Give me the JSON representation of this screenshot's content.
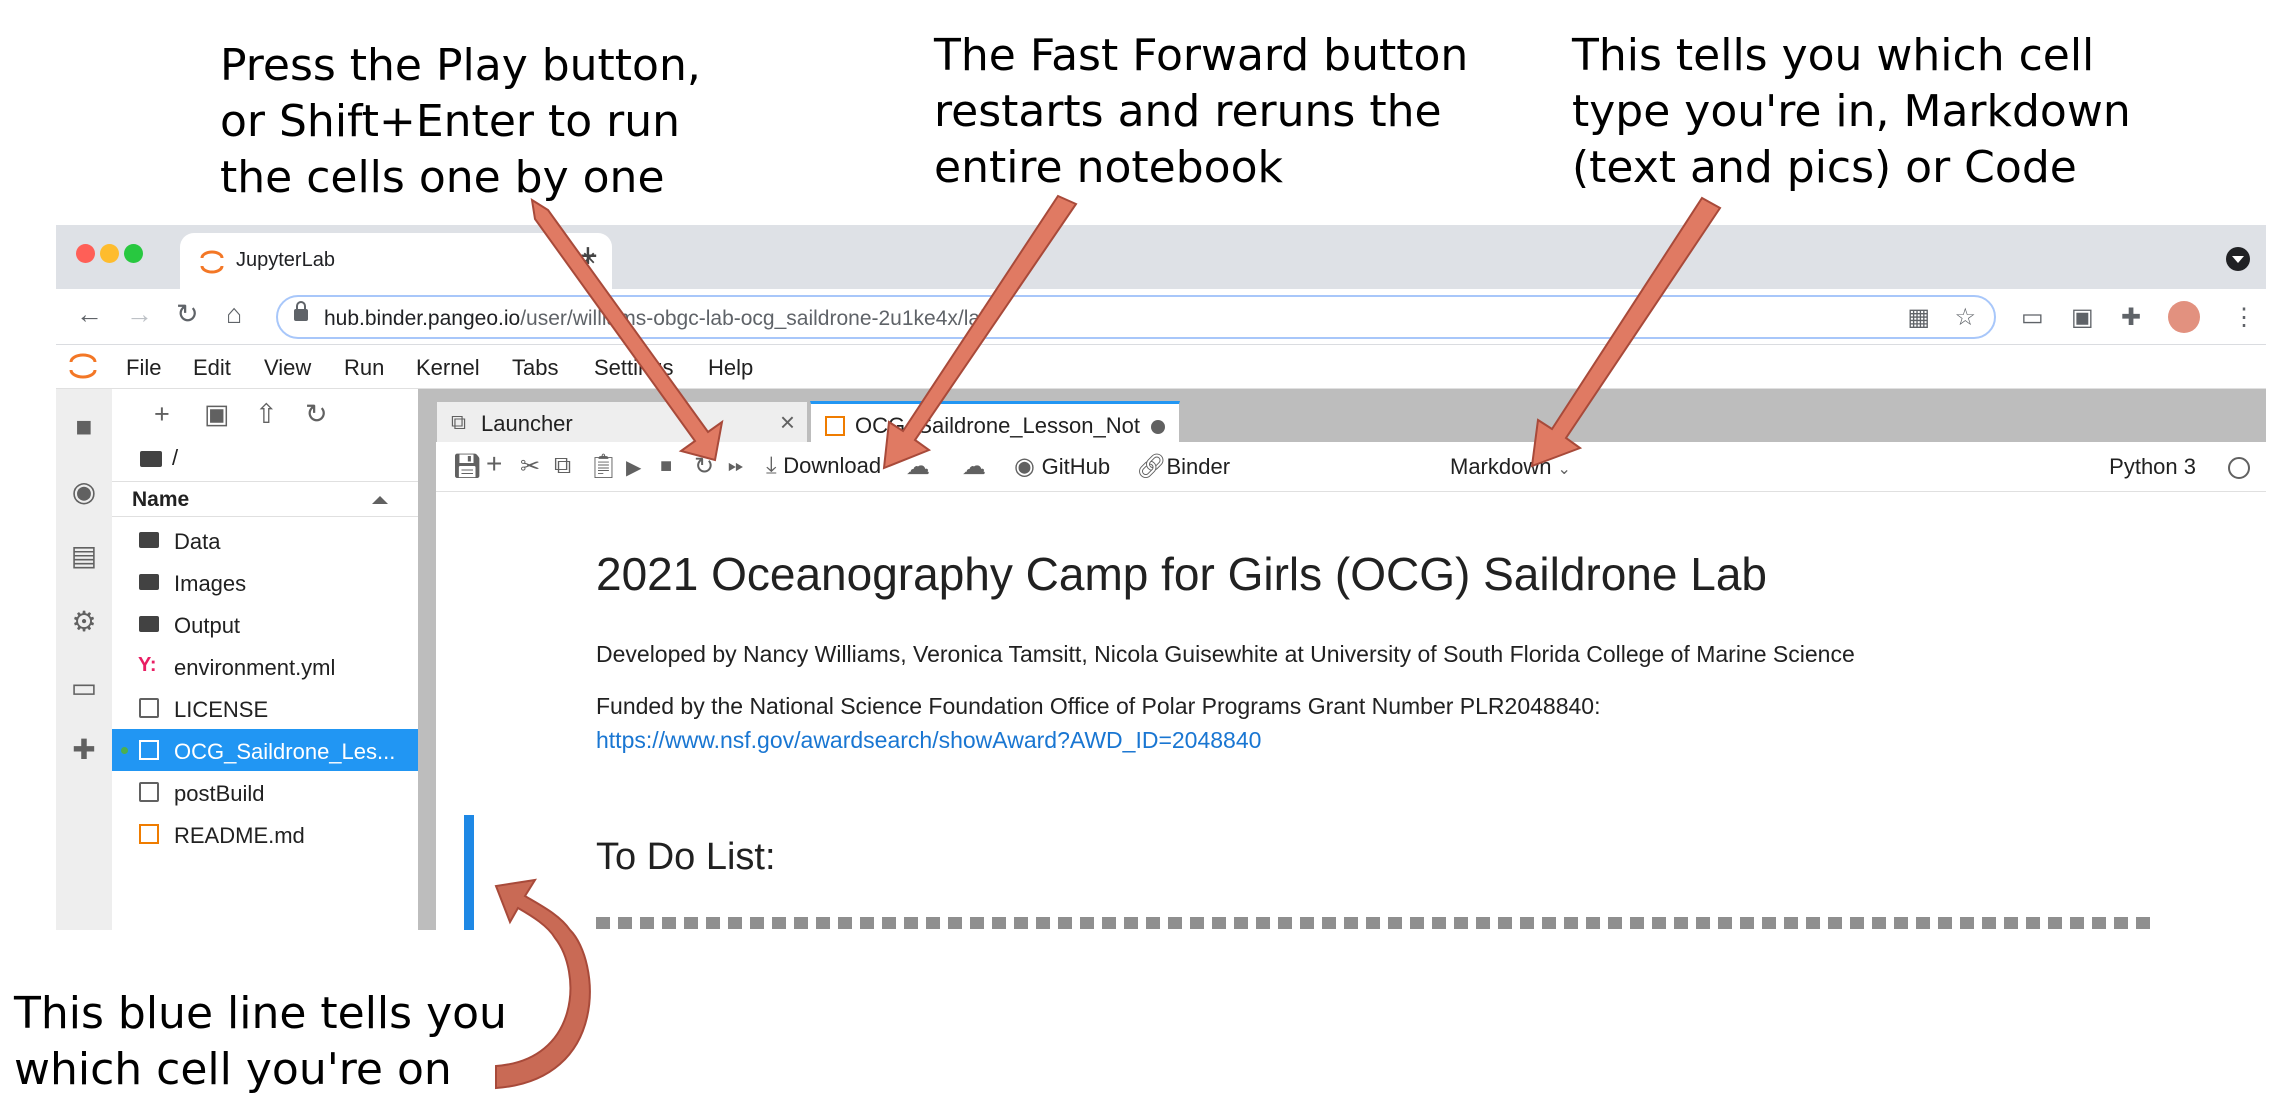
{
  "annotations": {
    "play": "Press the Play button,\nor Shift+Enter to run\nthe cells one by one",
    "fast_forward": "The Fast Forward button\nrestarts and reruns the\nentire notebook",
    "cell_type": "This tells you which cell\ntype you're in, Markdown\n(text and pics) or Code",
    "blue_line": "This blue line tells you\nwhich cell you're on"
  },
  "browser": {
    "tab_title": "JupyterLab",
    "url_host": "hub.binder.pangeo.io",
    "url_path": "/user/williams-obgc-lab-ocg_saildrone-2u1ke4x/lab"
  },
  "menu": [
    "File",
    "Edit",
    "View",
    "Run",
    "Kernel",
    "Tabs",
    "Settings",
    "Help"
  ],
  "filebrowser": {
    "path": "/",
    "header": "Name",
    "files": [
      {
        "name": "Data",
        "type": "folder"
      },
      {
        "name": "Images",
        "type": "folder"
      },
      {
        "name": "Output",
        "type": "folder"
      },
      {
        "name": "environment.yml",
        "type": "yml"
      },
      {
        "name": "LICENSE",
        "type": "file"
      },
      {
        "name": "OCG_Saildrone_Les...",
        "type": "notebook"
      },
      {
        "name": "postBuild",
        "type": "file"
      },
      {
        "name": "README.md",
        "type": "markdown"
      }
    ]
  },
  "tabs": {
    "launcher": "Launcher",
    "notebook": "OCG_Saildrone_Lesson_Not"
  },
  "toolbar": {
    "download": "Download",
    "github": "GitHub",
    "binder": "Binder",
    "cell_type": "Markdown",
    "kernel": "Python 3"
  },
  "notebook": {
    "title": "2021 Oceanography Camp for Girls (OCG) Saildrone Lab",
    "developed": "Developed by Nancy Williams, Veronica Tamsitt, Nicola Guisewhite at University of South Florida College of Marine Science",
    "funded": "Funded by the National Science Foundation Office of Polar Programs Grant Number PLR2048840:",
    "link": "https://www.nsf.gov/awardsearch/showAward?AWD_ID=2048840",
    "heading": "To Do List:"
  },
  "colors": {
    "arrow": "#e07a63",
    "arrow_stroke": "#a84a3a",
    "cell_indicator": "#1e88e5",
    "selected_file": "#2196f3"
  }
}
